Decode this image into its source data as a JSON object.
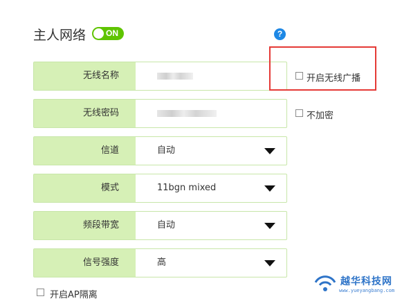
{
  "header": {
    "title": "主人网络",
    "toggle_label": "ON",
    "help_label": "?"
  },
  "fields": [
    {
      "label": "无线名称",
      "value": "",
      "kind": "text-masked"
    },
    {
      "label": "无线密码",
      "value": "",
      "kind": "text-masked"
    },
    {
      "label": "信道",
      "value": "自动",
      "kind": "select"
    },
    {
      "label": "模式",
      "value": "11bgn mixed",
      "kind": "select"
    },
    {
      "label": "频段带宽",
      "value": "自动",
      "kind": "select"
    },
    {
      "label": "信号强度",
      "value": "高",
      "kind": "select"
    }
  ],
  "options": {
    "hide_ssid": {
      "label": "开启无线广播",
      "checked": false
    },
    "no_encrypt": {
      "label": "不加密",
      "checked": false
    },
    "ap_isolation": {
      "label": "开启AP隔离",
      "checked": false
    }
  },
  "watermark": {
    "title": "越华科技网",
    "url": "www.yueyangbang.com"
  },
  "colors": {
    "accent_green": "#5fc400",
    "label_bg": "#d6f0b6",
    "highlight_red": "#e53935",
    "help_blue": "#1e88e5"
  }
}
